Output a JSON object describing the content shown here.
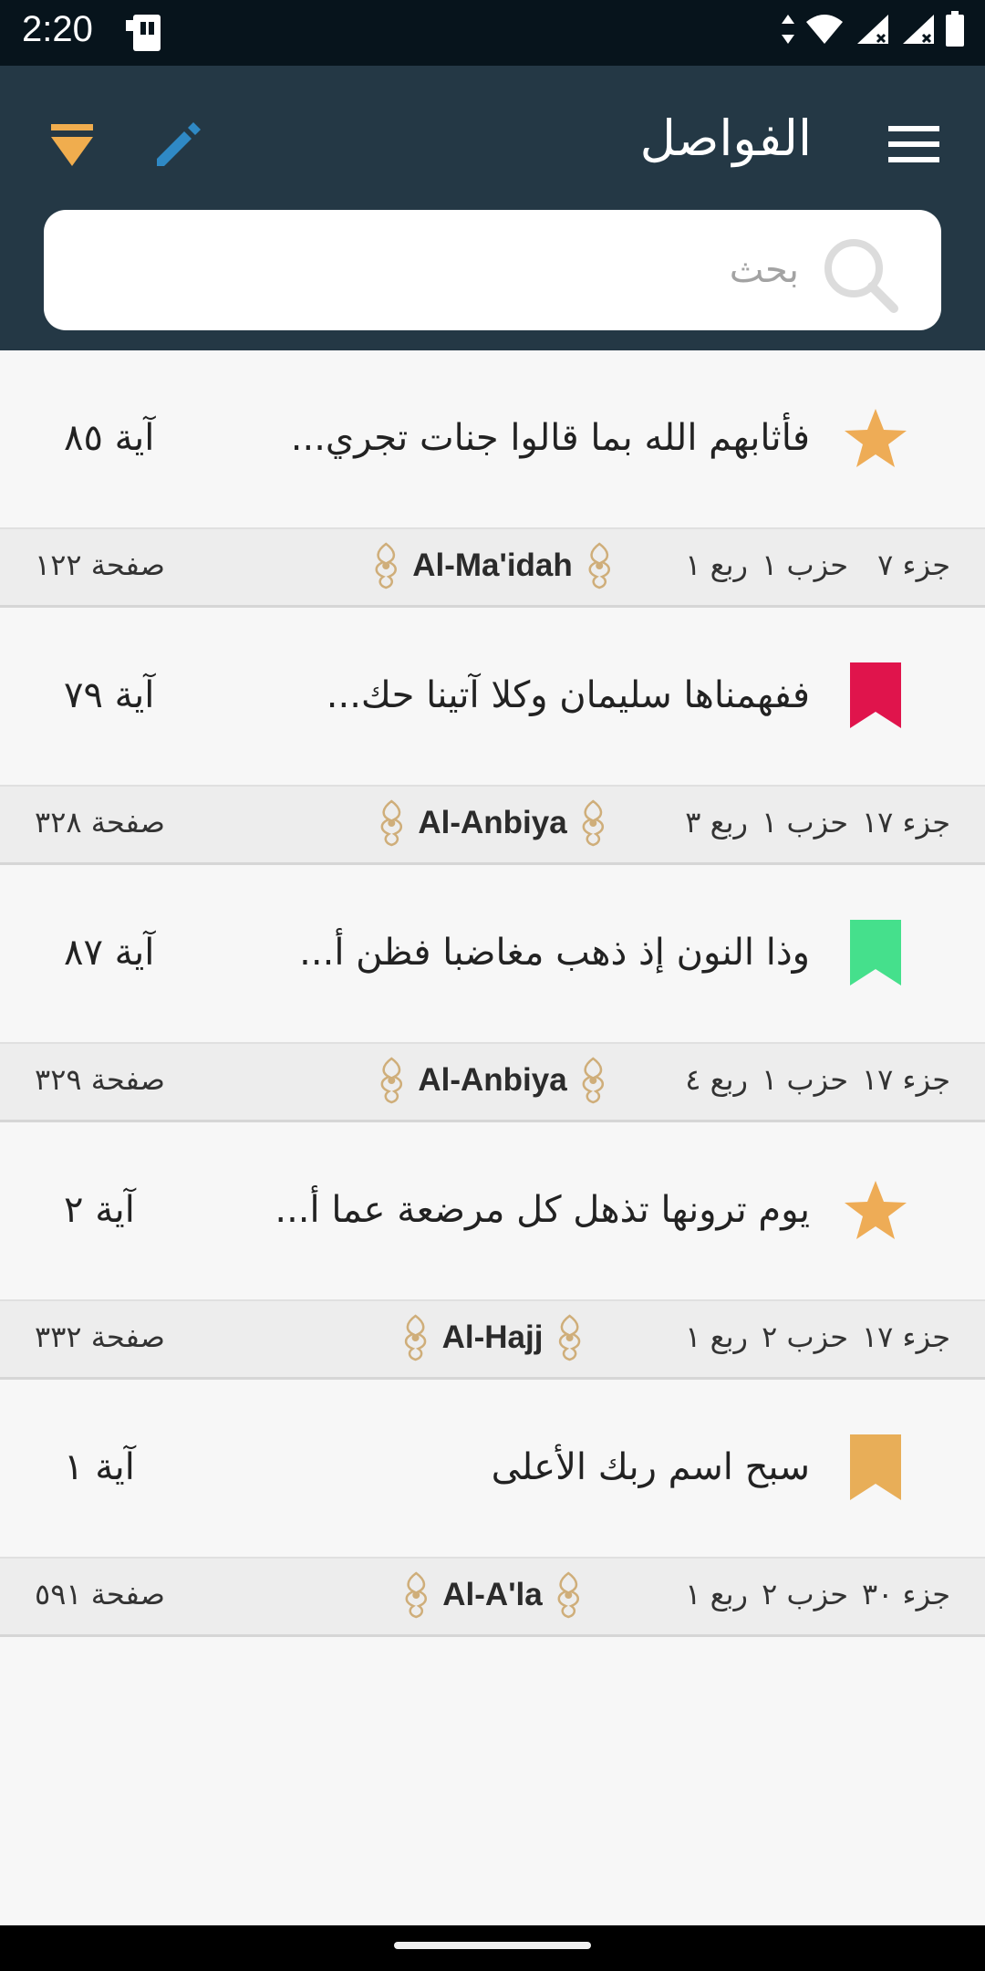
{
  "status_bar": {
    "time": "2:20"
  },
  "app_bar": {
    "title": "الفواصل"
  },
  "search": {
    "placeholder": "بحث",
    "value": ""
  },
  "colors": {
    "primary": "#243845",
    "accent_orange": "#f0ad4e",
    "pen_blue": "#2f89c5"
  },
  "items": [
    {
      "marker": "star-icon",
      "marker_color": "#eeac56",
      "verse": "فأثابهم الله بما قالوا جنات تجري...",
      "aya": "آية  ٨٥",
      "juz": "جزء ٧",
      "hizb": "حزب ١",
      "rub": "ربع ١",
      "surah": "Al-Ma'idah",
      "page": "صفحة ١٢٢"
    },
    {
      "marker": "bookmark-icon",
      "marker_color": "#e0144c",
      "verse": "ففهمناها سليمان وكلا آتينا حك...",
      "aya": "آية  ٧٩",
      "juz": "جزء ١٧",
      "hizb": "حزب ١",
      "rub": "ربع ٣",
      "surah": "Al-Anbiya",
      "page": "صفحة ٣٢٨"
    },
    {
      "marker": "bookmark-icon",
      "marker_color": "#45e08c",
      "verse": "وذا النون إذ ذهب مغاضبا فظن أ...",
      "aya": "آية  ٨٧",
      "juz": "جزء ١٧",
      "hizb": "حزب ١",
      "rub": "ربع ٤",
      "surah": "Al-Anbiya",
      "page": "صفحة ٣٢٩"
    },
    {
      "marker": "star-icon",
      "marker_color": "#eeac56",
      "verse": "يوم ترونها تذهل كل مرضعة عما أ...",
      "aya": "آية  ٢",
      "juz": "جزء ١٧",
      "hizb": "حزب ٢",
      "rub": "ربع ١",
      "surah": "Al-Hajj",
      "page": "صفحة ٣٣٢"
    },
    {
      "marker": "bookmark-icon",
      "marker_color": "#e8ae58",
      "verse": "سبح اسم ربك الأعلى",
      "aya": "آية  ١",
      "juz": "جزء ٣٠",
      "hizb": "حزب ٢",
      "rub": "ربع ١",
      "surah": "Al-A'la",
      "page": "صفحة ٥٩١"
    }
  ]
}
